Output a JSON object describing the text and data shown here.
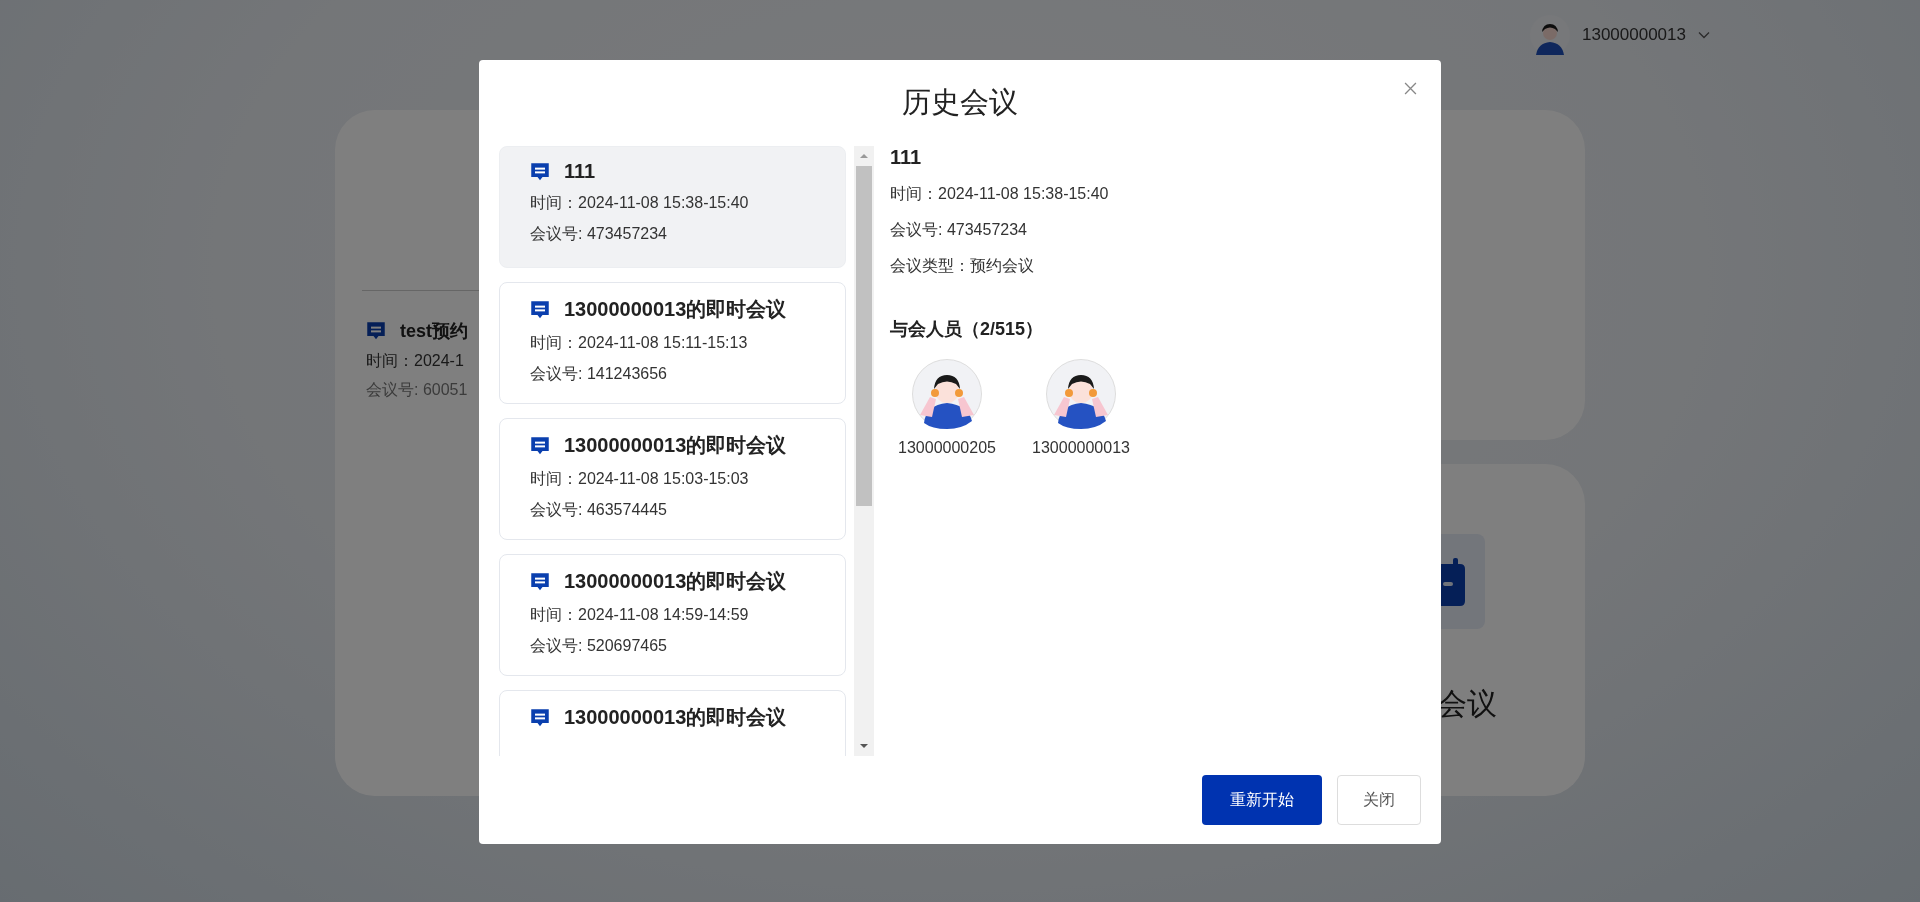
{
  "user_menu": {
    "name": "13000000013"
  },
  "background": {
    "left_card": {
      "items": [
        {
          "title": "test预约",
          "time": "时间：2024-1",
          "number": "会议号: 60051"
        }
      ]
    },
    "right_card": {
      "label": "会议"
    }
  },
  "dialog": {
    "title": "历史会议",
    "meetings": [
      {
        "title": "111",
        "time": "时间：2024-11-08 15:38-15:40",
        "number": "会议号: 473457234",
        "selected": true
      },
      {
        "title": "13000000013的即时会议",
        "time": "时间：2024-11-08 15:11-15:13",
        "number": "会议号: 141243656",
        "selected": false
      },
      {
        "title": "13000000013的即时会议",
        "time": "时间：2024-11-08 15:03-15:03",
        "number": "会议号: 463574445",
        "selected": false
      },
      {
        "title": "13000000013的即时会议",
        "time": "时间：2024-11-08 14:59-14:59",
        "number": "会议号: 520697465",
        "selected": false
      },
      {
        "title": "13000000013的即时会议",
        "selected": false
      }
    ],
    "detail": {
      "title": "111",
      "time": "时间：2024-11-08 15:38-15:40",
      "number": "会议号: 473457234",
      "type": "会议类型：预约会议",
      "attendees_heading": "与会人员（2/515）",
      "attendees": [
        {
          "name": "13000000205"
        },
        {
          "name": "13000000013"
        }
      ]
    },
    "buttons": [
      {
        "label": "重新开始",
        "kind": "primary"
      },
      {
        "label": "关闭",
        "kind": "default"
      }
    ]
  }
}
